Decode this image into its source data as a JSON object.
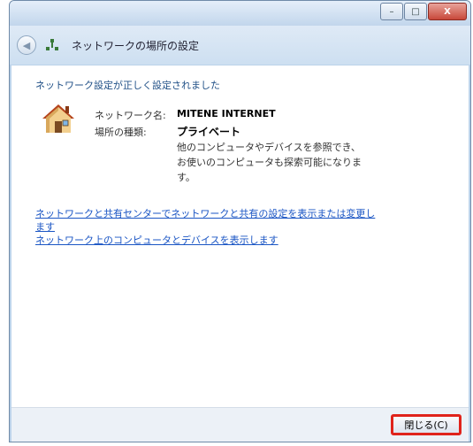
{
  "window": {
    "title": "ネットワークの場所の設定",
    "controls": {
      "minimize": "–",
      "maximize": "□",
      "close": "X"
    }
  },
  "content": {
    "heading": "ネットワーク設定が正しく設定されました",
    "network_name_label": "ネットワーク名:",
    "network_name_value": "MITENE INTERNET",
    "location_type_label": "場所の種類:",
    "location_type_value": "プライベート",
    "description_lines": [
      "他のコンピュータやデバイスを参照でき、",
      "お使いのコンピュータも探索可能になりま",
      "す。"
    ],
    "link_sharing_center_line1": "ネットワークと共有センターでネットワークと共有の設定を表示または変更し",
    "link_sharing_center_line2": "ます",
    "link_view_computers": "ネットワーク上のコンピュータとデバイスを表示します"
  },
  "footer": {
    "close_button": "閉じる(C)"
  },
  "colors": {
    "link": "#1a55c4",
    "heading": "#1f4f86",
    "highlight": "#e0231b"
  },
  "icons": [
    "back-arrow-icon",
    "network-icon",
    "house-icon"
  ]
}
